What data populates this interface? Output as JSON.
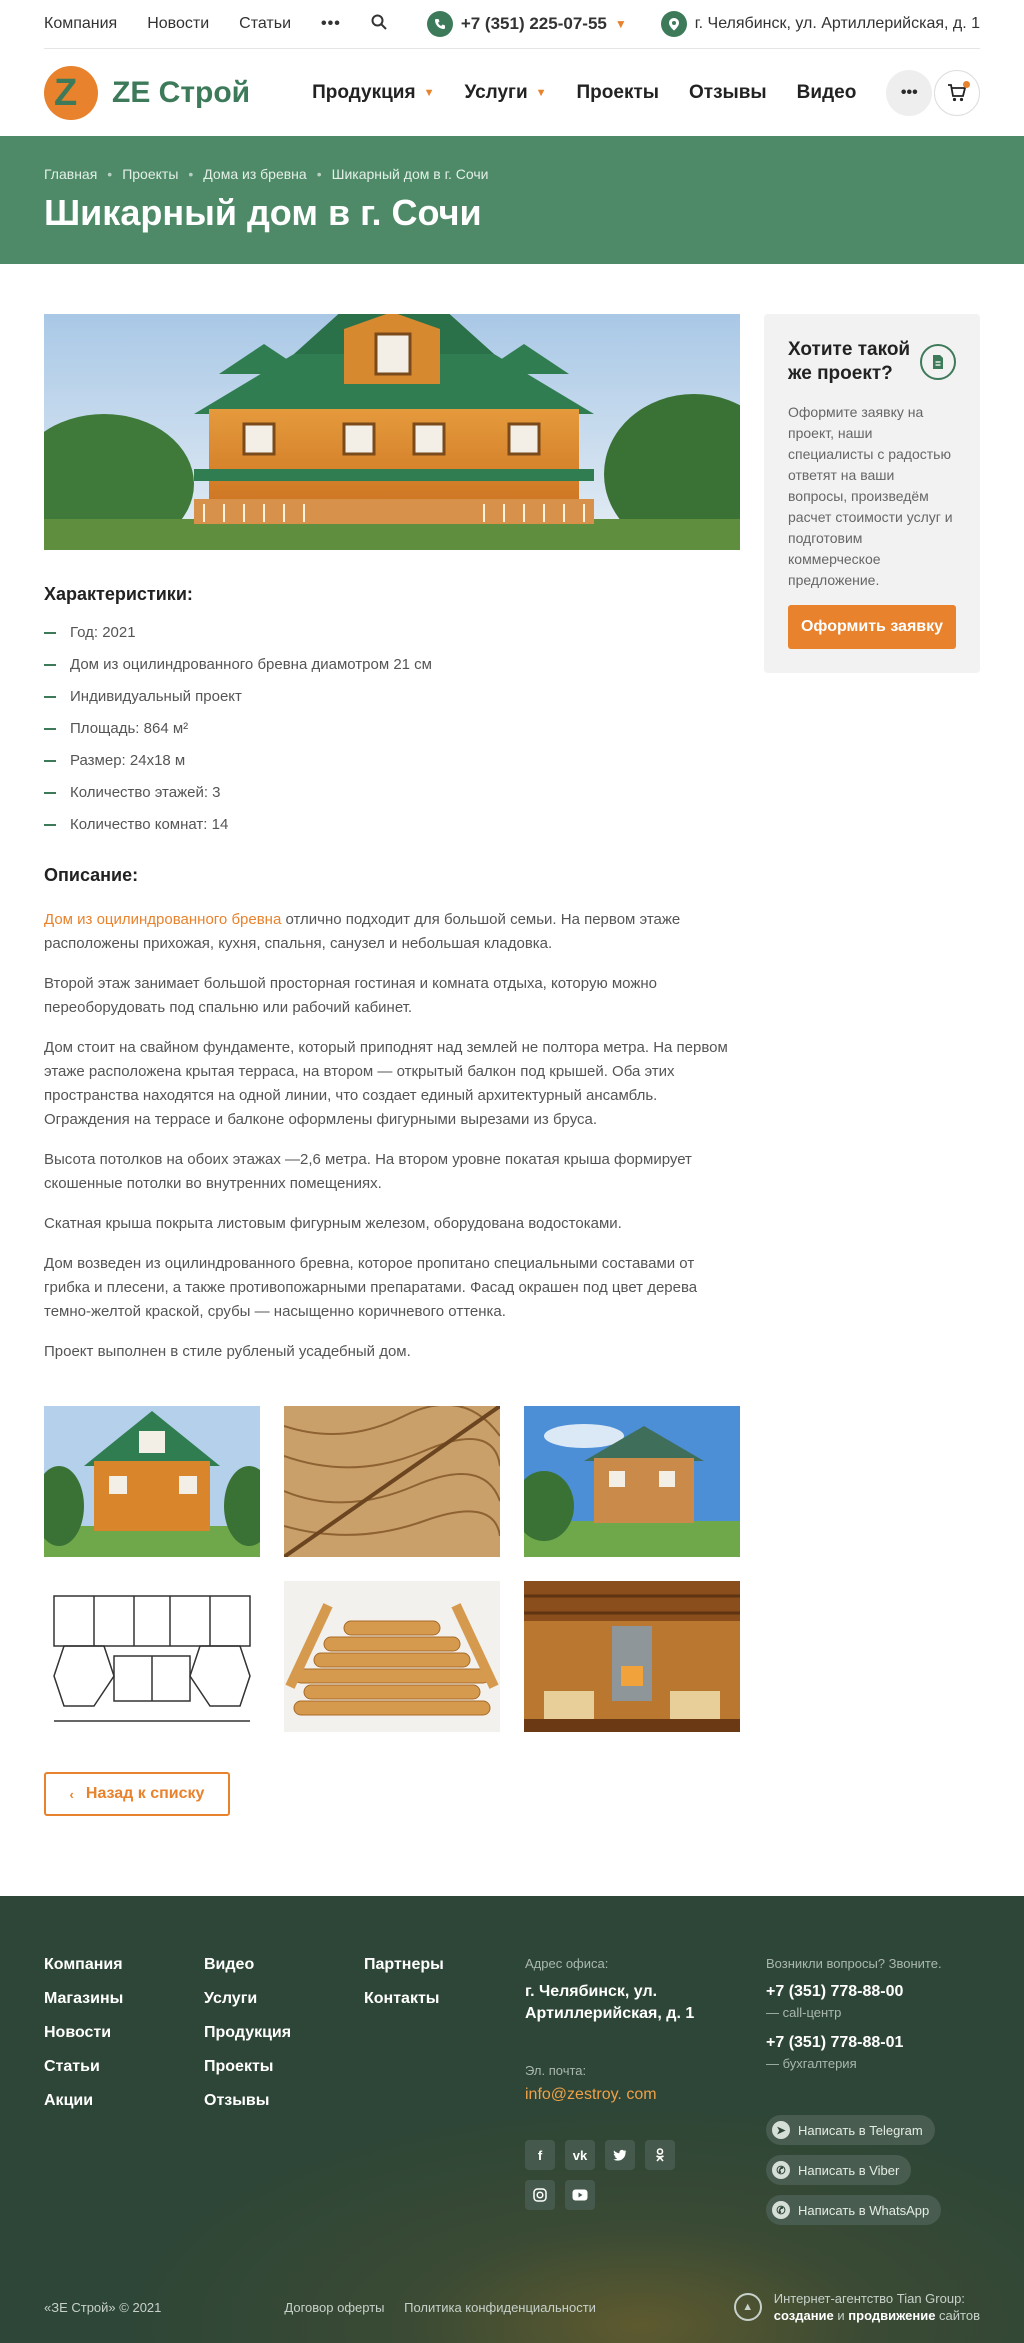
{
  "topbar": {
    "links": [
      "Компания",
      "Новости",
      "Статьи"
    ],
    "phone": "+7 (351) 225-07-55",
    "address": "г. Челябинск, ул. Артиллерийская, д. 1"
  },
  "header": {
    "logo_text": "ZE Строй",
    "logo_letter": "Z",
    "nav": [
      {
        "label": "Продукция",
        "dropdown": true
      },
      {
        "label": "Услуги",
        "dropdown": true
      },
      {
        "label": "Проекты",
        "dropdown": false
      },
      {
        "label": "Отзывы",
        "dropdown": false
      },
      {
        "label": "Видео",
        "dropdown": false
      }
    ]
  },
  "hero": {
    "breadcrumbs": [
      "Главная",
      "Проекты",
      "Дома из бревна",
      "Шикарный дом в г. Сочи"
    ],
    "title": "Шикарный дом в г. Сочи"
  },
  "characteristics": {
    "heading": "Характеристики:",
    "items": [
      "Год: 2021",
      "Дом из оцилиндрованного бревна диамотром 21 см",
      "Индивидуальный проект",
      "Площадь: 864 м²",
      "Размер: 24х18 м",
      "Количество этажей: 3",
      "Количество комнат: 14"
    ]
  },
  "description": {
    "heading": "Описание:",
    "link_text": "Дом из оцилиндрованного бревна",
    "first_rest": " отлично подходит для большой семьи. На первом этаже расположены прихожая, кухня, спальня, санузел и небольшая кладовка.",
    "paragraphs": [
      "Второй этаж занимает большой просторная гостиная и комната отдыха, которую можно переоборудовать под спальню или рабочий кабинет.",
      "Дом стоит на свайном фундаменте, который приподнят над землей не полтора метра. На первом этаже расположена крытая терраса, на втором — открытый балкон под крышей. Оба этих пространства находятся на одной линии, что создает единый архитектурный ансамбль. Ограждения на террасе и балконе оформлены фигурными вырезами из бруса.",
      "Высота потолков на обоих этажах —2,6 метра. На втором уровне покатая крыша формирует скошенные потолки во внутренних помещениях.",
      "Скатная крыша покрыта листовым фигурным железом, оборудована водостоками.",
      "Дом возведен из оцилиндрованного бревна, которое пропитано специальными составами от грибка и плесени, а также противопожарными препаратами. Фасад окрашен под цвет дерева темно-желтой краской, срубы — насыщенно коричневого оттенка.",
      "Проект выполнен в стиле рубленый усадебный дом."
    ]
  },
  "back_button": "Назад к списку",
  "sidebar": {
    "title": "Хотите такой же проект?",
    "text": "Оформите заявку на проект, наши специалисты с радостью ответят на ваши вопросы, произведём расчет стоимости услуг и подготовим коммерческое предложение.",
    "button": "Оформить заявку"
  },
  "footer": {
    "col1": [
      "Компания",
      "Магазины",
      "Новости",
      "Статьи",
      "Акции"
    ],
    "col2": [
      "Видео",
      "Услуги",
      "Продукция",
      "Проекты",
      "Отзывы"
    ],
    "col3": [
      "Партнеры",
      "Контакты"
    ],
    "address_label": "Адрес офиса:",
    "address": "г. Челябинск, ул. Артиллерийская, д. 1",
    "email_label": "Эл. почта:",
    "email": "info@zestroy. com",
    "contact_label": "Возникли вопросы? Звоните.",
    "phones": [
      {
        "number": "+7 (351) 778-88-00",
        "note": "— call-центр"
      },
      {
        "number": "+7 (351) 778-88-01",
        "note": "— бухгалтерия"
      }
    ],
    "messengers": [
      "Написать в Telegram",
      "Написать в Viber",
      "Написать в WhatsApp"
    ],
    "copyright": "«ЗЕ Строй» © 2021",
    "legal": [
      "Договор оферты",
      "Политика конфиденциальности"
    ],
    "agency_line1": "Интернет-агентство Tian Group:",
    "agency_strong1": "создание",
    "agency_mid": " и ",
    "agency_strong2": "продвижение",
    "agency_end": " сайтов"
  },
  "colors": {
    "accent": "#e8822c",
    "brand_green": "#3d7a5a",
    "hero_green": "#4e8a67",
    "footer": "#2e4637"
  }
}
